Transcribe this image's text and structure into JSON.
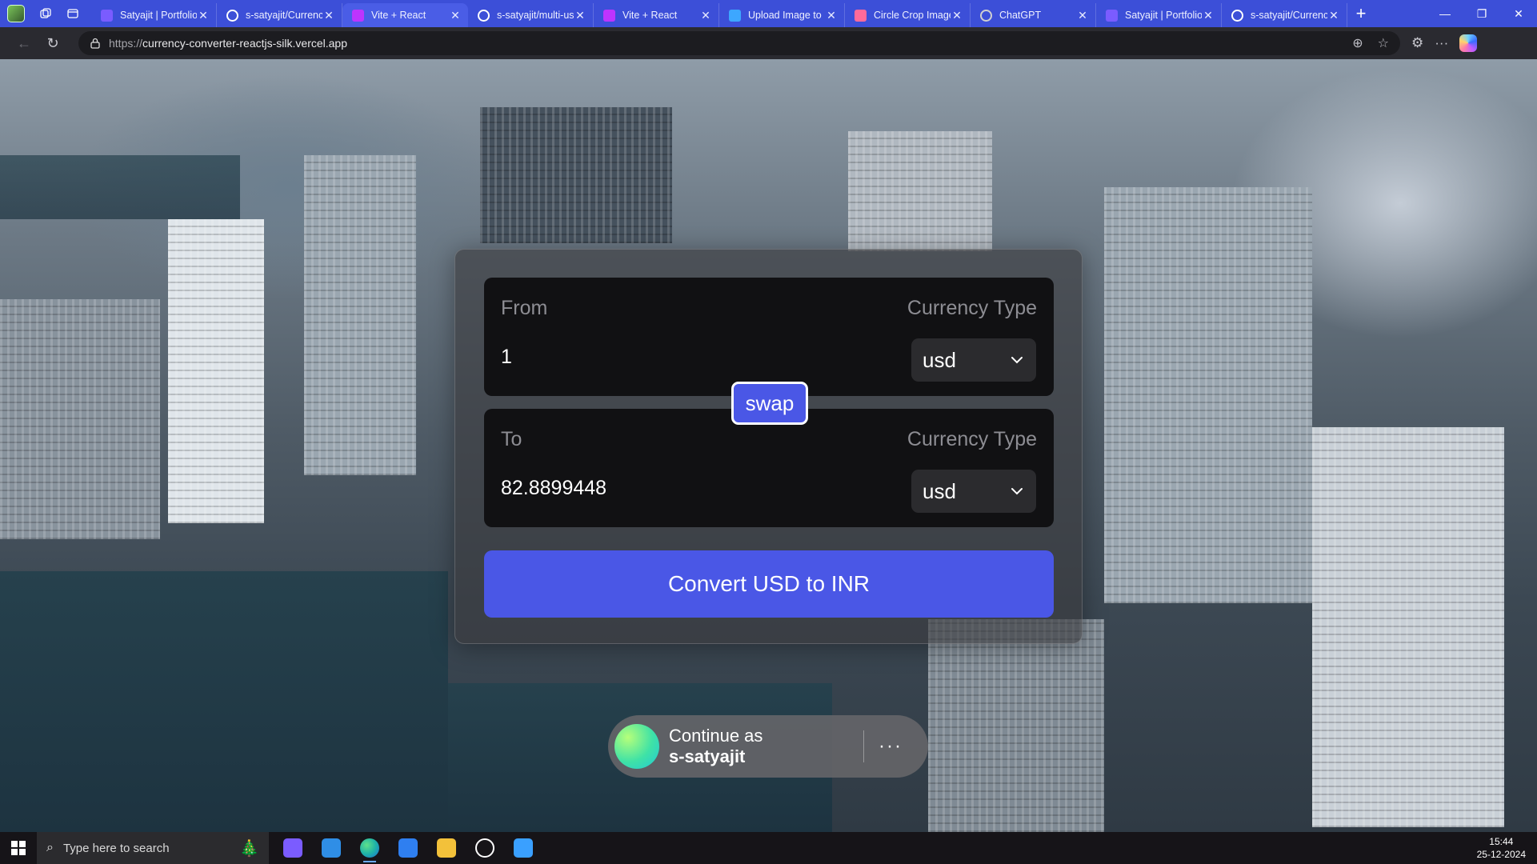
{
  "browser": {
    "tabs": [
      {
        "title": "Satyajit | Portfolio",
        "icon": "portfolio-favicon",
        "color": "#7a5cff",
        "active": false
      },
      {
        "title": "s-satyajit/Currency",
        "icon": "github-icon",
        "color": "#ffffff",
        "active": false
      },
      {
        "title": "Vite + React",
        "icon": "vite-icon",
        "color": "#bd34fe",
        "active": true
      },
      {
        "title": "s-satyajit/multi-us",
        "icon": "github-icon",
        "color": "#ffffff",
        "active": false
      },
      {
        "title": "Vite + React",
        "icon": "vite-icon",
        "color": "#bd34fe",
        "active": false
      },
      {
        "title": "Upload Image to I",
        "icon": "upload-icon",
        "color": "#3da7ff",
        "active": false
      },
      {
        "title": "Circle Crop Image",
        "icon": "crop-icon",
        "color": "#ff6a9a",
        "active": false
      },
      {
        "title": "ChatGPT",
        "icon": "chatgpt-icon",
        "color": "#d0d0d0",
        "active": false
      },
      {
        "title": "Satyajit | Portfolio",
        "icon": "portfolio-favicon",
        "color": "#7a5cff",
        "active": false
      },
      {
        "title": "s-satyajit/Currency",
        "icon": "github-icon",
        "color": "#ffffff",
        "active": false
      }
    ],
    "url_protocol": "https://",
    "url_host": "currency-converter-reactjs-silk.vercel.app",
    "accent": "#3c4fd8"
  },
  "converter": {
    "from": {
      "label": "From",
      "type_label": "Currency Type",
      "amount": "1",
      "currency": "usd"
    },
    "to": {
      "label": "To",
      "type_label": "Currency Type",
      "amount": "82.8899448",
      "currency": "usd"
    },
    "swap_label": "swap",
    "convert_label": "Convert USD to INR",
    "button_color": "#4a57e6"
  },
  "one_tap": {
    "line1": "Continue as",
    "line2": "s-satyajit",
    "more": "···"
  },
  "taskbar": {
    "search_placeholder": "Type here to search",
    "apps": [
      {
        "icon": "copilot-icon",
        "color": "#7b5cff"
      },
      {
        "icon": "vscode-icon",
        "color": "#2f8ee6"
      },
      {
        "icon": "edge-icon",
        "color": "#1fb3a6"
      },
      {
        "icon": "todo-icon",
        "color": "#2f7ff0"
      },
      {
        "icon": "file-explorer-icon",
        "color": "#f3c13a"
      },
      {
        "icon": "threads-icon",
        "color": "#ffffff"
      },
      {
        "icon": "photos-icon",
        "color": "#3aa0ff"
      }
    ],
    "time": "15:44",
    "date": "25-12-2024"
  }
}
